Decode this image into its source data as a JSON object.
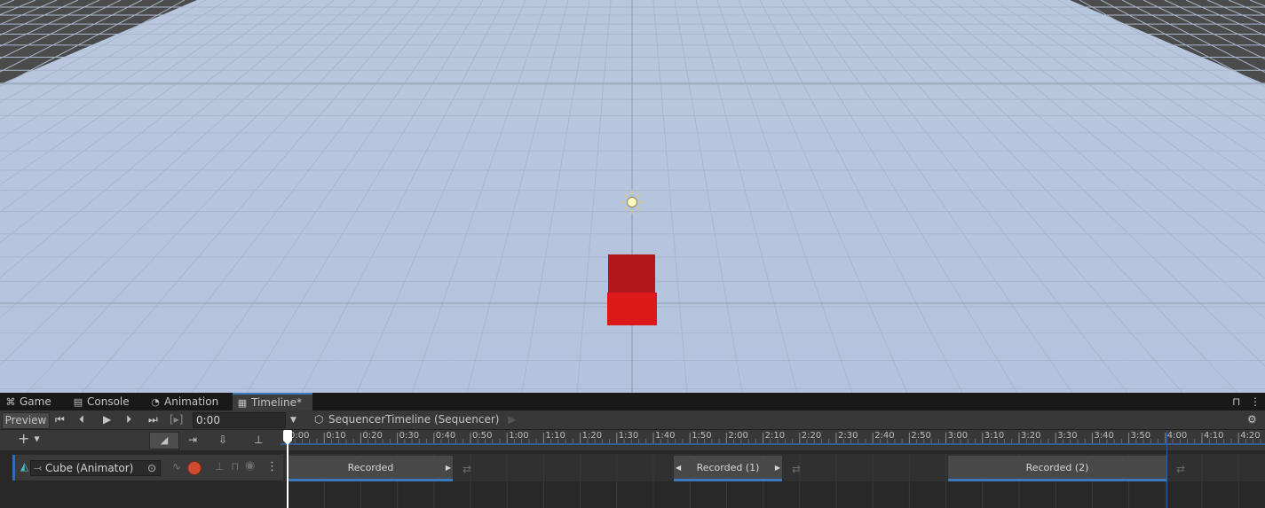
{
  "tabs": [
    {
      "label": "Game",
      "icon": "gamepad-icon"
    },
    {
      "label": "Console",
      "icon": "console-icon"
    },
    {
      "label": "Animation",
      "icon": "clock-icon"
    },
    {
      "label": "Timeline*",
      "icon": "film-icon"
    }
  ],
  "toolbar": {
    "preview_label": "Preview",
    "frame_label": "[▸]",
    "time_value": "0:00",
    "breadcrumb": "SequencerTimeline (Sequencer)"
  },
  "ruler": {
    "ticks": [
      "0:00",
      "0:10",
      "0:20",
      "0:30",
      "0:40",
      "0:50",
      "1:00",
      "1:10",
      "1:20",
      "1:30",
      "1:40",
      "1:50",
      "2:00",
      "2:10",
      "2:20",
      "2:30",
      "2:40",
      "2:50",
      "3:00",
      "3:10",
      "3:20",
      "3:30",
      "3:40",
      "3:50",
      "4:00",
      "4:10",
      "4:20"
    ]
  },
  "track": {
    "binding": "Cube (Animator)",
    "clips": [
      {
        "name": "Recorded"
      },
      {
        "name": "Recorded (1)"
      },
      {
        "name": "Recorded (2)"
      }
    ]
  },
  "colors": {
    "sky": "#b7c6df",
    "cube": "#d41919",
    "accent": "#3a79bb"
  }
}
